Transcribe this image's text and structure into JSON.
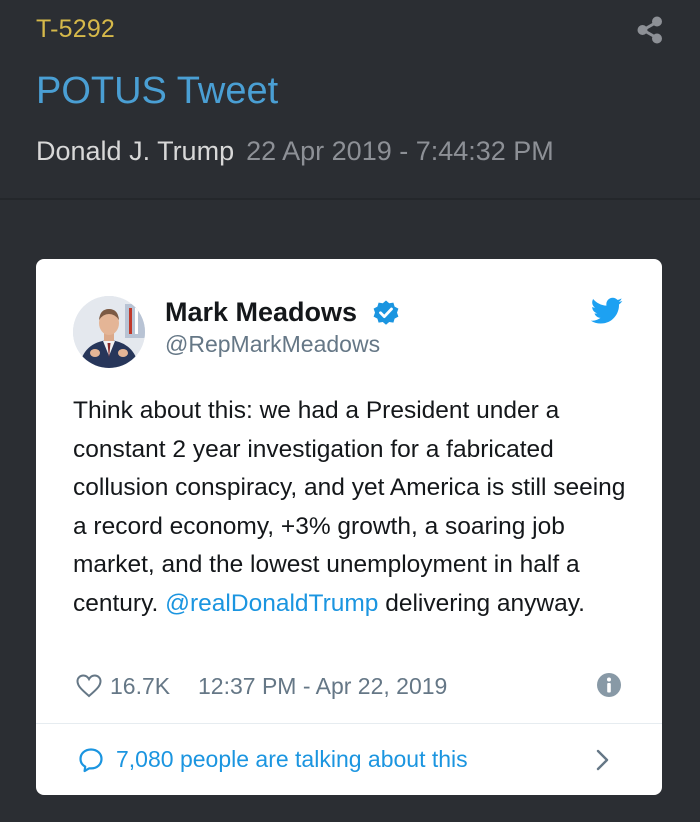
{
  "post": {
    "id": "T-5292",
    "title": "POTUS Tweet",
    "author": "Donald J. Trump",
    "date": "22 Apr 2019 - 7:44:32 PM",
    "share_icon": "share-icon"
  },
  "tweet": {
    "display_name": "Mark Meadows",
    "handle": "@RepMarkMeadows",
    "verified": true,
    "text": "Think about this: we had a President under a constant 2 year investigation for a fabricated collusion conspiracy, and yet America is still seeing a record economy, +3% growth, a soaring job market, and the lowest unemployment in half a century.",
    "mention": "@realDonaldTrump",
    "text_after_mention": " delivering anyway.",
    "likes": "16.7K",
    "timestamp": "12:37 PM - Apr 22, 2019",
    "talking": "7,080 people are talking about this"
  },
  "colors": {
    "background": "#2b2e33",
    "post_id": "#d6b94a",
    "title": "#4a9fd4",
    "twitter_blue": "#1b95e0",
    "card": "#ffffff"
  }
}
